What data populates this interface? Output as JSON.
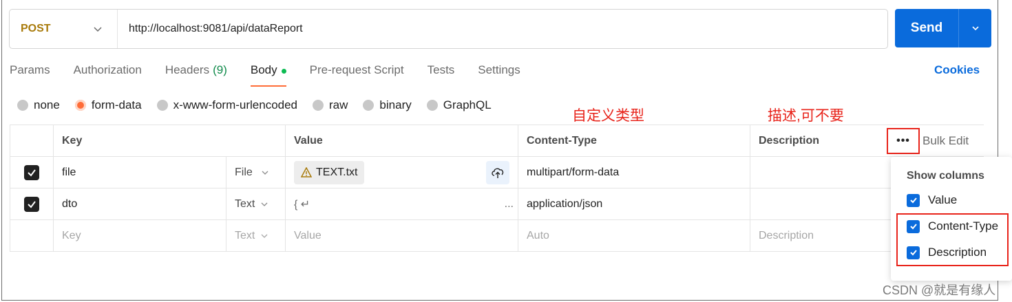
{
  "request": {
    "method": "POST",
    "url": "http://localhost:9081/api/dataReport",
    "send_label": "Send"
  },
  "tabs": [
    {
      "label": "Params"
    },
    {
      "label": "Authorization"
    },
    {
      "label": "Headers",
      "count": "(9)"
    },
    {
      "label": "Body",
      "active": true
    },
    {
      "label": "Pre-request Script"
    },
    {
      "label": "Tests"
    },
    {
      "label": "Settings"
    }
  ],
  "cookies_label": "Cookies",
  "body_types": [
    {
      "label": "none",
      "selected": false
    },
    {
      "label": "form-data",
      "selected": true
    },
    {
      "label": "x-www-form-urlencoded",
      "selected": false
    },
    {
      "label": "raw",
      "selected": false
    },
    {
      "label": "binary",
      "selected": false
    },
    {
      "label": "GraphQL",
      "selected": false
    }
  ],
  "annotations": {
    "custom_type": "自定义类型",
    "description_optional": "描述,可不要"
  },
  "table": {
    "headers": {
      "key": "Key",
      "value": "Value",
      "content_type": "Content-Type",
      "description": "Description"
    },
    "more_label": "•••",
    "bulk_edit": "Bulk Edit",
    "rows": [
      {
        "key": "file",
        "type": "File",
        "value": "TEXT.txt",
        "content_type": "multipart/form-data",
        "description": ""
      },
      {
        "key": "dto",
        "type": "Text",
        "value": "{ ↵",
        "value_more": "...",
        "content_type": "application/json",
        "description": ""
      }
    ],
    "placeholder_row": {
      "key": "Key",
      "type": "Text",
      "value": "Value",
      "content_type": "Auto",
      "description": "Description"
    }
  },
  "columns_menu": {
    "title": "Show columns",
    "items": [
      {
        "label": "Value",
        "checked": true
      },
      {
        "label": "Content-Type",
        "checked": true
      },
      {
        "label": "Description",
        "checked": true
      }
    ]
  },
  "watermark": "CSDN @就是有缘人",
  "colors": {
    "accent": "#0a6bdc",
    "active_tab": "#ff6c37",
    "method": "#a87a0a",
    "annotation": "#e8231a"
  }
}
